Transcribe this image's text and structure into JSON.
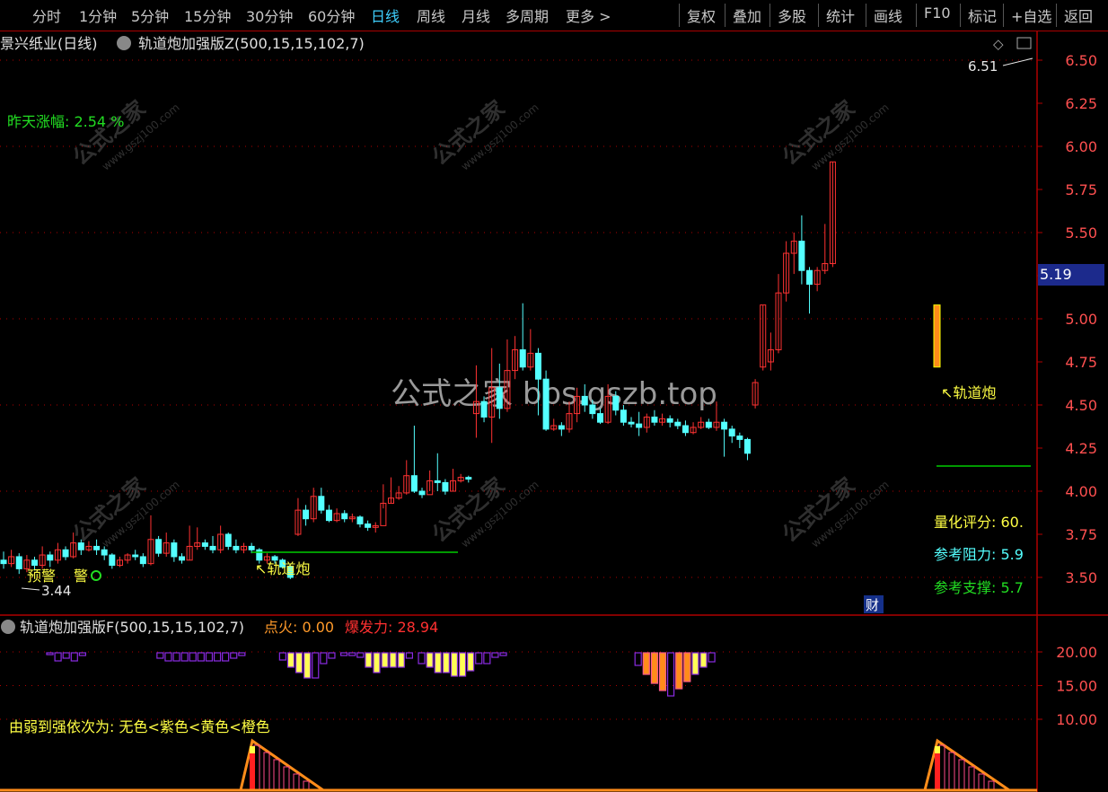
{
  "toolbar": {
    "left_items": [
      "分时",
      "1分钟",
      "5分钟",
      "15分钟",
      "30分钟",
      "60分钟",
      "日线",
      "周线",
      "月线",
      "多周期",
      "更多 >"
    ],
    "active": "日线",
    "right_items": [
      "复权",
      "叠加",
      "多股",
      "统计",
      "画线",
      "F10",
      "标记",
      "+自选",
      "返回"
    ]
  },
  "header": {
    "stock": "景兴纸业(日线)",
    "indicator": "轨道炮加强版Z(500,15,15,102,7)"
  },
  "main_panel": {
    "yesterday_change": "昨天涨幅: 2.54 %",
    "max_price_label": "6.51",
    "min_price_label": "3.44",
    "current_price_tag": "5.19",
    "signal_left": "↖轨道炮",
    "signal_right": "↖轨道炮",
    "warning_left": "预警",
    "warning_mid": "警",
    "score": "量化评分: 60.",
    "resistance": "参考阻力: 5.9",
    "support": "参考支撑: 5.7",
    "finance_tag": "财",
    "watermark": "公式之家 bbs.gszb.top",
    "wm_text": "公式之家",
    "wm_url": "www.gszj100.com"
  },
  "sub_panel": {
    "indicator": "轨道炮加强版F(500,15,15,102,7)",
    "ignite": "点火: 0.00",
    "power": "爆发力: 28.94",
    "legend": "由弱到强依次为: 无色<紫色<黄色<橙色"
  },
  "colors": {
    "up": "#ff3232",
    "down": "#54ffff",
    "axis": "#b00000",
    "grid": "#b00000",
    "yellow": "#ffff55",
    "green": "#00cc00",
    "purple": "#8a2be2",
    "orange": "#ff8c1a"
  },
  "chart_data": {
    "type": "candlestick",
    "price_axis_ticks": [
      3.5,
      3.75,
      4.0,
      4.25,
      4.5,
      4.75,
      5.0,
      5.25,
      5.5,
      5.75,
      6.0,
      6.25,
      6.5
    ],
    "sub_axis_ticks": [
      10.0,
      15.0,
      20.0
    ],
    "candles": [
      [
        3.6,
        3.58,
        3.65,
        3.55
      ],
      [
        3.58,
        3.62,
        3.66,
        3.56
      ],
      [
        3.62,
        3.55,
        3.64,
        3.52
      ],
      [
        3.55,
        3.6,
        3.63,
        3.53
      ],
      [
        3.6,
        3.57,
        3.62,
        3.54
      ],
      [
        3.57,
        3.63,
        3.68,
        3.55
      ],
      [
        3.63,
        3.6,
        3.65,
        3.56
      ],
      [
        3.6,
        3.66,
        3.7,
        3.58
      ],
      [
        3.66,
        3.62,
        3.68,
        3.6
      ],
      [
        3.62,
        3.7,
        3.76,
        3.61
      ],
      [
        3.7,
        3.66,
        3.72,
        3.63
      ],
      [
        3.66,
        3.68,
        3.71,
        3.65
      ],
      [
        3.68,
        3.66,
        3.72,
        3.63
      ],
      [
        3.66,
        3.63,
        3.68,
        3.6
      ],
      [
        3.63,
        3.57,
        3.64,
        3.55
      ],
      [
        3.57,
        3.6,
        3.62,
        3.56
      ],
      [
        3.6,
        3.63,
        3.64,
        3.58
      ],
      [
        3.63,
        3.62,
        3.66,
        3.6
      ],
      [
        3.62,
        3.58,
        3.64,
        3.56
      ],
      [
        3.58,
        3.72,
        3.86,
        3.57
      ],
      [
        3.72,
        3.64,
        3.74,
        3.62
      ],
      [
        3.64,
        3.7,
        3.76,
        3.62
      ],
      [
        3.7,
        3.62,
        3.72,
        3.59
      ],
      [
        3.62,
        3.6,
        3.64,
        3.58
      ],
      [
        3.6,
        3.68,
        3.8,
        3.6
      ],
      [
        3.68,
        3.7,
        3.79,
        3.66
      ],
      [
        3.7,
        3.68,
        3.72,
        3.66
      ],
      [
        3.68,
        3.66,
        3.74,
        3.64
      ],
      [
        3.66,
        3.75,
        3.8,
        3.64
      ],
      [
        3.75,
        3.68,
        3.76,
        3.66
      ],
      [
        3.68,
        3.66,
        3.72,
        3.64
      ],
      [
        3.66,
        3.68,
        3.7,
        3.64
      ],
      [
        3.68,
        3.66,
        3.7,
        3.64
      ],
      [
        3.66,
        3.6,
        3.67,
        3.58
      ],
      [
        3.6,
        3.62,
        3.64,
        3.58
      ],
      [
        3.62,
        3.6,
        3.63,
        3.58
      ],
      [
        3.6,
        3.56,
        3.61,
        3.55
      ],
      [
        3.56,
        3.5,
        3.57,
        3.49
      ],
      [
        3.75,
        3.89,
        3.96,
        3.74
      ],
      [
        3.89,
        3.84,
        3.92,
        3.8
      ],
      [
        3.84,
        3.97,
        4.02,
        3.82
      ],
      [
        3.97,
        3.89,
        4.02,
        3.87
      ],
      [
        3.89,
        3.83,
        3.92,
        3.82
      ],
      [
        3.83,
        3.87,
        3.9,
        3.82
      ],
      [
        3.87,
        3.84,
        3.89,
        3.82
      ],
      [
        3.84,
        3.85,
        3.87,
        3.82
      ],
      [
        3.85,
        3.81,
        3.86,
        3.79
      ],
      [
        3.81,
        3.79,
        3.83,
        3.77
      ],
      [
        3.79,
        3.8,
        3.82,
        3.76
      ],
      [
        3.8,
        3.93,
        4.04,
        3.9
      ],
      [
        3.93,
        3.96,
        4.08,
        3.93
      ],
      [
        3.96,
        3.99,
        4.03,
        3.95
      ],
      [
        3.99,
        4.09,
        4.18,
        3.98
      ],
      [
        4.09,
        4.0,
        4.38,
        3.99
      ],
      [
        4.0,
        3.98,
        4.02,
        3.96
      ],
      [
        3.98,
        4.06,
        4.12,
        4.0
      ],
      [
        4.06,
        4.05,
        4.22,
        4.0
      ],
      [
        4.05,
        4.0,
        4.07,
        3.98
      ],
      [
        4.0,
        4.06,
        4.13,
        4.0
      ],
      [
        4.06,
        4.08,
        4.1,
        4.05
      ],
      [
        4.08,
        4.07,
        4.09,
        4.05
      ],
      [
        4.45,
        4.52,
        4.73,
        4.31
      ],
      [
        4.52,
        4.43,
        4.55,
        4.4
      ],
      [
        4.43,
        4.6,
        4.83,
        4.28
      ],
      [
        4.6,
        4.48,
        4.74,
        4.42
      ],
      [
        4.48,
        4.7,
        4.88,
        4.46
      ],
      [
        4.7,
        4.82,
        4.9,
        4.65
      ],
      [
        4.82,
        4.72,
        5.09,
        4.7
      ],
      [
        4.72,
        4.8,
        4.94,
        4.7
      ],
      [
        4.8,
        4.65,
        4.83,
        4.44
      ],
      [
        4.65,
        4.36,
        4.7,
        4.35
      ],
      [
        4.36,
        4.38,
        4.42,
        4.35
      ],
      [
        4.38,
        4.36,
        4.4,
        4.32
      ],
      [
        4.36,
        4.45,
        4.52,
        4.34
      ],
      [
        4.45,
        4.55,
        4.6,
        4.4
      ],
      [
        4.55,
        4.5,
        4.62,
        4.46
      ],
      [
        4.5,
        4.45,
        4.53,
        4.42
      ],
      [
        4.45,
        4.4,
        4.48,
        4.39
      ],
      [
        4.4,
        4.55,
        4.62,
        4.39
      ],
      [
        4.55,
        4.47,
        4.58,
        4.44
      ],
      [
        4.47,
        4.4,
        4.5,
        4.38
      ],
      [
        4.4,
        4.39,
        4.43,
        4.37
      ],
      [
        4.39,
        4.37,
        4.46,
        4.32
      ],
      [
        4.37,
        4.43,
        4.45,
        4.34
      ],
      [
        4.43,
        4.4,
        4.47,
        4.38
      ],
      [
        4.4,
        4.42,
        4.45,
        4.38
      ],
      [
        4.42,
        4.4,
        4.44,
        4.37
      ],
      [
        4.4,
        4.38,
        4.42,
        4.36
      ],
      [
        4.38,
        4.34,
        4.41,
        4.32
      ],
      [
        4.34,
        4.37,
        4.4,
        4.33
      ],
      [
        4.37,
        4.4,
        4.43,
        4.36
      ],
      [
        4.4,
        4.37,
        4.42,
        4.36
      ],
      [
        4.37,
        4.4,
        4.52,
        4.35
      ],
      [
        4.4,
        4.36,
        4.42,
        4.2
      ],
      [
        4.36,
        4.32,
        4.38,
        4.28
      ],
      [
        4.32,
        4.3,
        4.34,
        4.25
      ],
      [
        4.3,
        4.22,
        4.31,
        4.18
      ],
      [
        4.5,
        4.63,
        4.65,
        4.48
      ],
      [
        4.72,
        5.08,
        5.08,
        4.7
      ],
      [
        4.75,
        4.82,
        4.92,
        4.7
      ],
      [
        4.82,
        5.15,
        5.26,
        4.8
      ],
      [
        5.15,
        5.38,
        5.45,
        5.1
      ],
      [
        5.38,
        5.45,
        5.5,
        5.26
      ],
      [
        5.45,
        5.28,
        5.6,
        5.2
      ],
      [
        5.28,
        5.2,
        5.3,
        5.03
      ],
      [
        5.2,
        5.28,
        5.3,
        5.16
      ],
      [
        5.28,
        5.32,
        5.55,
        5.26
      ],
      [
        5.32,
        5.91,
        5.91,
        5.3
      ]
    ],
    "sub_bars": [
      [
        0,
        2,
        "purple"
      ],
      [
        2,
        9,
        "purple"
      ],
      [
        4,
        6,
        "purple"
      ],
      [
        6,
        9,
        "purple"
      ],
      [
        8,
        3,
        "purple"
      ],
      [
        27,
        6,
        "purple"
      ],
      [
        29,
        9,
        "purple"
      ],
      [
        31,
        9,
        "purple"
      ],
      [
        33,
        9,
        "purple"
      ],
      [
        35,
        9,
        "purple"
      ],
      [
        37,
        9,
        "purple"
      ],
      [
        39,
        9,
        "purple"
      ],
      [
        41,
        9,
        "purple"
      ],
      [
        43,
        9,
        "purple"
      ],
      [
        45,
        6,
        "purple"
      ],
      [
        47,
        3,
        "purple"
      ],
      [
        57,
        8,
        "purple"
      ],
      [
        59,
        16,
        "yellow"
      ],
      [
        61,
        22,
        "yellow"
      ],
      [
        63,
        28,
        "yellow"
      ],
      [
        65,
        28,
        "purple"
      ],
      [
        67,
        12,
        "purple"
      ],
      [
        69,
        6,
        "purple"
      ],
      [
        72,
        3,
        "purple"
      ],
      [
        74,
        3,
        "purple"
      ],
      [
        76,
        5,
        "purple"
      ],
      [
        78,
        16,
        "yellow"
      ],
      [
        80,
        22,
        "yellow"
      ],
      [
        82,
        16,
        "yellow"
      ],
      [
        84,
        16,
        "yellow"
      ],
      [
        86,
        16,
        "yellow"
      ],
      [
        88,
        6,
        "purple"
      ],
      [
        91,
        12,
        "purple"
      ],
      [
        93,
        16,
        "yellow"
      ],
      [
        95,
        22,
        "yellow"
      ],
      [
        97,
        22,
        "yellow"
      ],
      [
        99,
        26,
        "yellow"
      ],
      [
        101,
        26,
        "yellow"
      ],
      [
        103,
        20,
        "yellow"
      ],
      [
        105,
        12,
        "purple"
      ],
      [
        107,
        12,
        "purple"
      ],
      [
        109,
        5,
        "purple"
      ],
      [
        111,
        3,
        "purple"
      ],
      [
        144,
        14,
        "purple"
      ],
      [
        146,
        24,
        "orange"
      ],
      [
        148,
        34,
        "orange"
      ],
      [
        150,
        42,
        "orange"
      ],
      [
        152,
        48,
        "purple"
      ],
      [
        154,
        40,
        "orange"
      ],
      [
        156,
        32,
        "orange"
      ],
      [
        158,
        24,
        "yellow"
      ],
      [
        160,
        16,
        "yellow"
      ],
      [
        162,
        10,
        "purple"
      ]
    ]
  }
}
